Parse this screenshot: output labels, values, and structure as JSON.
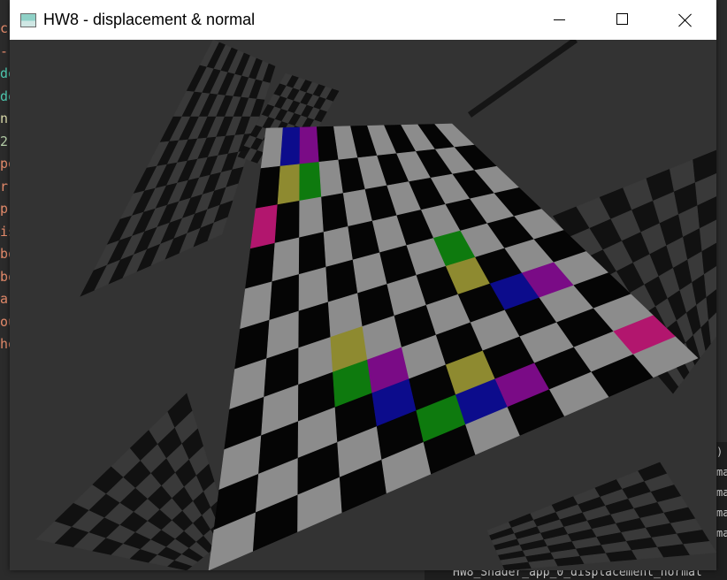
{
  "window": {
    "title": "HW8 - displacement & normal",
    "icon": "app-window-icon"
  },
  "background": {
    "left_editor_fragments": [
      "c",
      "-",
      "de",
      "de",
      "n(",
      "2",
      "pe",
      "rr",
      "p",
      "is",
      "bo",
      "bo",
      "ar",
      "ou",
      "he"
    ],
    "terminal_fragments": [
      ")",
      "ma",
      "ma",
      "ma",
      "ma"
    ],
    "terminal_bottom_line": "HW8_Shader_app_0_displacement_normal"
  },
  "scene": {
    "description_colors": {
      "dark_square": "#050505",
      "light_square": "#8c8c8c",
      "magenta": "#b2166e",
      "blue": "#0c0c8c",
      "green": "#0e7a0e",
      "yellow": "#8e8a30",
      "purple": "#7a0b86",
      "clear_color": "#333333"
    }
  }
}
